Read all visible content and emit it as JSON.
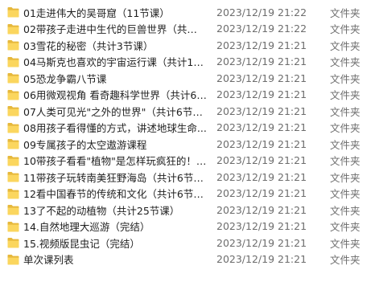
{
  "colors": {
    "folder_back": "#e6b83c",
    "folder_front": "#fbd65e",
    "name_text": "#1f1f1f",
    "meta_text": "#6d6d6d"
  },
  "files": [
    {
      "name": "01走进伟大的吴哥窟（11节课）",
      "date": "2023/12/19 21:22",
      "type": "文件夹",
      "icon": "folder-icon"
    },
    {
      "name": "02带孩子走进中生代的巨兽世界（共计1...",
      "date": "2023/12/19 21:22",
      "type": "文件夹",
      "icon": "folder-icon"
    },
    {
      "name": "03雪花的秘密（共计3节课）",
      "date": "2023/12/19 21:21",
      "type": "文件夹",
      "icon": "folder-icon"
    },
    {
      "name": "04马斯克也喜欢的宇宙运行课（共计12...",
      "date": "2023/12/19 21:21",
      "type": "文件夹",
      "icon": "folder-icon"
    },
    {
      "name": "05恐龙争霸八节课",
      "date": "2023/12/19 21:21",
      "type": "文件夹",
      "icon": "folder-icon"
    },
    {
      "name": "06用微观视角 看奇趣科学世界（共计6节...",
      "date": "2023/12/19 21:21",
      "type": "文件夹",
      "icon": "folder-icon"
    },
    {
      "name": "07人类可见光\"之外的世界\"（共计6节课）",
      "date": "2023/12/19 21:21",
      "type": "文件夹",
      "icon": "folder-icon"
    },
    {
      "name": "08用孩子看得懂的方式，讲述地球生命...",
      "date": "2023/12/19 21:21",
      "type": "文件夹",
      "icon": "folder-icon"
    },
    {
      "name": "09专属孩子的太空遨游课程",
      "date": "2023/12/19 21:21",
      "type": "文件夹",
      "icon": "folder-icon"
    },
    {
      "name": "10带孩子看看\"植物\"是怎样玩疯狂的！（...",
      "date": "2023/12/19 21:21",
      "type": "文件夹",
      "icon": "folder-icon"
    },
    {
      "name": "11带孩子玩转南美狂野海岛（共计6节课）",
      "date": "2023/12/19 21:21",
      "type": "文件夹",
      "icon": "folder-icon"
    },
    {
      "name": "12看中国春节的传统和文化（共计6节课）",
      "date": "2023/12/19 21:21",
      "type": "文件夹",
      "icon": "folder-icon"
    },
    {
      "name": "13了不起的动植物（共计25节课）",
      "date": "2023/12/19 21:21",
      "type": "文件夹",
      "icon": "folder-icon"
    },
    {
      "name": "14.自然地理大巡游（完结）",
      "date": "2023/12/19 21:21",
      "type": "文件夹",
      "icon": "folder-icon"
    },
    {
      "name": "15.视频版昆虫记（完结）",
      "date": "2023/12/19 21:21",
      "type": "文件夹",
      "icon": "folder-icon"
    },
    {
      "name": "单次课列表",
      "date": "2023/12/19 21:21",
      "type": "文件夹",
      "icon": "folder-icon"
    }
  ]
}
